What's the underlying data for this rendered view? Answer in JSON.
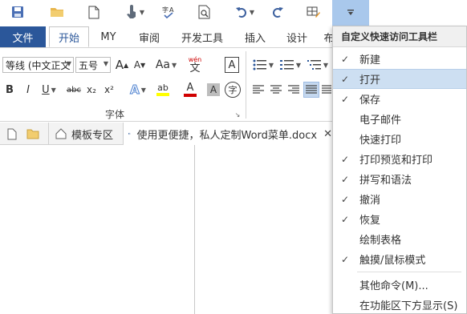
{
  "ribbon": {
    "tabs": [
      "文件",
      "开始",
      "MY",
      "审阅",
      "开发工具",
      "插入",
      "设计",
      "布"
    ],
    "font_name": "等线 (中文正文",
    "font_size": "五号",
    "font_size_up": "A",
    "font_size_down": "A",
    "change_case": "Aa",
    "pinyin": "wén",
    "pinyin_char": "文",
    "char_border": "A",
    "bold": "B",
    "italic": "I",
    "underline": "U",
    "strike": "abc",
    "subscript": "x₂",
    "superscript": "x²",
    "text_effect": "A",
    "highlight": "ab",
    "font_color": "A",
    "char_shading": "A",
    "enclose_char": "字",
    "font_group_label": "字体",
    "highlight_color": "#ffff00",
    "font_color_value": "#d00000"
  },
  "doc_tabs": {
    "templates": "模板专区",
    "document": "使用更便捷，私人定制Word菜单.docx",
    "close": "✕"
  },
  "menu": {
    "title": "自定义快速访问工具栏",
    "items": [
      {
        "label": "新建",
        "checked": "✓"
      },
      {
        "label": "打开",
        "checked": "✓"
      },
      {
        "label": "保存",
        "checked": "✓"
      },
      {
        "label": "电子邮件",
        "checked": ""
      },
      {
        "label": "快速打印",
        "checked": ""
      },
      {
        "label": "打印预览和打印",
        "checked": "✓"
      },
      {
        "label": "拼写和语法",
        "checked": "✓"
      },
      {
        "label": "撤消",
        "checked": "✓"
      },
      {
        "label": "恢复",
        "checked": "✓"
      },
      {
        "label": "绘制表格",
        "checked": ""
      },
      {
        "label": "触摸/鼠标模式",
        "checked": "✓"
      },
      {
        "label": "其他命令(M)...",
        "checked": ""
      },
      {
        "label": "在功能区下方显示(S)",
        "checked": ""
      }
    ]
  },
  "colors": {
    "accent": "#2b579a",
    "menu_highlight": "#cddff2",
    "qat_selected": "#a9c8ec"
  }
}
